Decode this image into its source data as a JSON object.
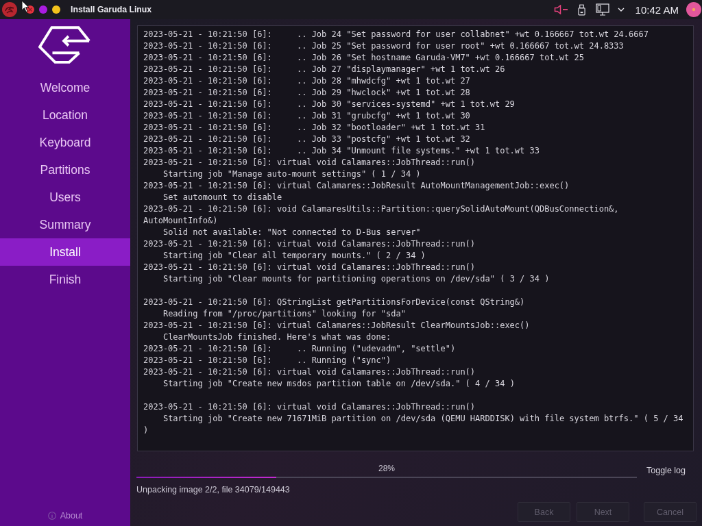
{
  "top_bar": {
    "window_buttons": [
      {
        "kind": "close",
        "color": "#e5333d"
      },
      {
        "kind": "minimize",
        "color": "#a91ce0"
      },
      {
        "kind": "maximize",
        "color": "#f3c21c"
      }
    ],
    "title": "Install Garuda Linux",
    "tray": {
      "speaker_muted": true,
      "clock": "10:42 AM"
    }
  },
  "sidebar": {
    "items": [
      {
        "label": "Welcome",
        "selected": false
      },
      {
        "label": "Location",
        "selected": false
      },
      {
        "label": "Keyboard",
        "selected": false
      },
      {
        "label": "Partitions",
        "selected": false
      },
      {
        "label": "Users",
        "selected": false
      },
      {
        "label": "Summary",
        "selected": false
      },
      {
        "label": "Install",
        "selected": true
      },
      {
        "label": "Finish",
        "selected": false
      }
    ],
    "about": "About"
  },
  "log": {
    "blocks": [
      [
        "2023-05-21 - 10:21:50 [6]:     .. Job 24 \"Set password for user collabnet\" +wt 0.166667 tot.wt 24.6667",
        "2023-05-21 - 10:21:50 [6]:     .. Job 25 \"Set password for user root\" +wt 0.166667 tot.wt 24.8333",
        "2023-05-21 - 10:21:50 [6]:     .. Job 26 \"Set hostname Garuda-VM7\" +wt 0.166667 tot.wt 25",
        "2023-05-21 - 10:21:50 [6]:     .. Job 27 \"displaymanager\" +wt 1 tot.wt 26",
        "2023-05-21 - 10:21:50 [6]:     .. Job 28 \"mhwdcfg\" +wt 1 tot.wt 27",
        "2023-05-21 - 10:21:50 [6]:     .. Job 29 \"hwclock\" +wt 1 tot.wt 28",
        "2023-05-21 - 10:21:50 [6]:     .. Job 30 \"services-systemd\" +wt 1 tot.wt 29",
        "2023-05-21 - 10:21:50 [6]:     .. Job 31 \"grubcfg\" +wt 1 tot.wt 30",
        "2023-05-21 - 10:21:50 [6]:     .. Job 32 \"bootloader\" +wt 1 tot.wt 31",
        "2023-05-21 - 10:21:50 [6]:     .. Job 33 \"postcfg\" +wt 1 tot.wt 32",
        "2023-05-21 - 10:21:50 [6]:     .. Job 34 \"Unmount file systems.\" +wt 1 tot.wt 33",
        "2023-05-21 - 10:21:50 [6]: virtual void Calamares::JobThread::run()",
        "    Starting job \"Manage auto-mount settings\" ( 1 / 34 )",
        "2023-05-21 - 10:21:50 [6]: virtual Calamares::JobResult AutoMountManagementJob::exec()",
        "    Set automount to disable",
        "2023-05-21 - 10:21:50 [6]: void CalamaresUtils::Partition::querySolidAutoMount(QDBusConnection&, AutoMountInfo&)",
        "    Solid not available: \"Not connected to D-Bus server\"",
        "2023-05-21 - 10:21:50 [6]: virtual void Calamares::JobThread::run()",
        "    Starting job \"Clear all temporary mounts.\" ( 2 / 34 )",
        "2023-05-21 - 10:21:50 [6]: virtual void Calamares::JobThread::run()",
        "    Starting job \"Clear mounts for partitioning operations on /dev/sda\" ( 3 / 34 )"
      ],
      [
        "2023-05-21 - 10:21:50 [6]: QStringList getPartitionsForDevice(const QString&)",
        "    Reading from \"/proc/partitions\" looking for \"sda\"",
        "2023-05-21 - 10:21:50 [6]: virtual Calamares::JobResult ClearMountsJob::exec()",
        "    ClearMountsJob finished. Here's what was done:",
        "2023-05-21 - 10:21:50 [6]:     .. Running (\"udevadm\", \"settle\")",
        "2023-05-21 - 10:21:50 [6]:     .. Running (\"sync\")",
        "2023-05-21 - 10:21:50 [6]: virtual void Calamares::JobThread::run()",
        "    Starting job \"Create new msdos partition table on /dev/sda.\" ( 4 / 34 )"
      ],
      [
        "2023-05-21 - 10:21:50 [6]: virtual void Calamares::JobThread::run()",
        "    Starting job \"Create new 71671MiB partition on /dev/sda (QEMU HARDDISK) with file system btrfs.\" ( 5 / 34 )"
      ]
    ]
  },
  "footer": {
    "progress": {
      "label": "28%",
      "level": 0.28
    },
    "toggle_log": "Toggle log",
    "status": "Unpacking image 2/2, file 34079/149443",
    "buttons": [
      {
        "kind": "back",
        "label": "Back",
        "disabled": true
      },
      {
        "kind": "next",
        "label": "Next",
        "disabled": true
      },
      {
        "kind": "cancel",
        "label": "Cancel",
        "disabled": true
      }
    ]
  }
}
